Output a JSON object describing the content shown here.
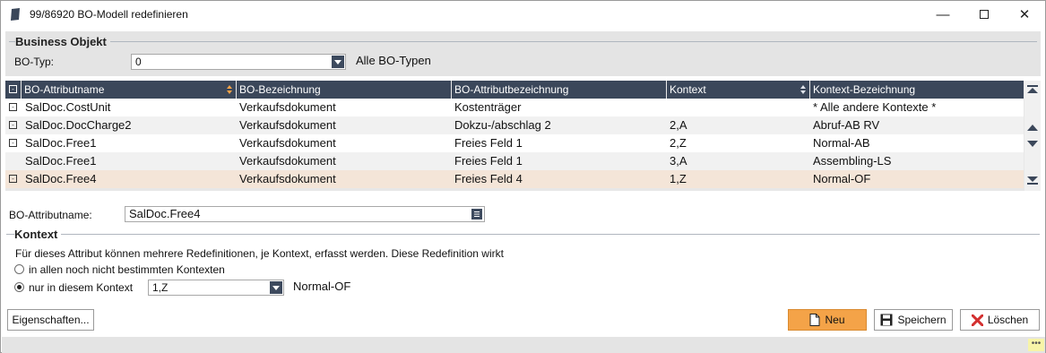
{
  "window": {
    "title": "99/86920 BO-Modell redefinieren",
    "min_label": "—",
    "close_label": "✕"
  },
  "business_objekt": {
    "legend": "Business Objekt",
    "bo_typ_label": "BO-Typ:",
    "bo_typ_value": "0",
    "bo_typ_desc": "Alle BO-Typen"
  },
  "grid": {
    "columns": [
      {
        "label": "BO-Attributname",
        "sorted": true
      },
      {
        "label": "BO-Bezeichnung"
      },
      {
        "label": "BO-Attributbezeichnung"
      },
      {
        "label": "Kontext",
        "sortable": true
      },
      {
        "label": "Kontext-Bezeichnung"
      }
    ],
    "header_expander": "-",
    "rows": [
      {
        "expander": "-",
        "name": "SalDoc.CostUnit",
        "bez": "Verkaufsdokument",
        "attr_bez": "Kostenträger",
        "kontext": "",
        "kontext_bez": "* Alle andere Kontexte *",
        "style": "white"
      },
      {
        "expander": "-",
        "name": "SalDoc.DocCharge2",
        "bez": "Verkaufsdokument",
        "attr_bez": "Dokzu-/abschlag 2",
        "kontext": "2,A",
        "kontext_bez": "Abruf-AB RV",
        "style": "grey"
      },
      {
        "expander": "-",
        "name": "SalDoc.Free1",
        "bez": "Verkaufsdokument",
        "attr_bez": "Freies Feld 1",
        "kontext": "2,Z",
        "kontext_bez": "Normal-AB",
        "style": "white"
      },
      {
        "expander": "",
        "name": "SalDoc.Free1",
        "bez": "Verkaufsdokument",
        "attr_bez": "Freies Feld 1",
        "kontext": "3,A",
        "kontext_bez": "Assembling-LS",
        "style": "grey"
      },
      {
        "expander": "-",
        "name": "SalDoc.Free4",
        "bez": "Verkaufsdokument",
        "attr_bez": "Freies Feld 4",
        "kontext": "1,Z",
        "kontext_bez": "Normal-OF",
        "style": "selected"
      }
    ]
  },
  "attr": {
    "label": "BO-Attributname:",
    "value": "SalDoc.Free4"
  },
  "kontext": {
    "legend": "Kontext",
    "info": "Für dieses Attribut können mehrere Redefinitionen, je Kontext, erfasst werden. Diese Redefinition wirkt",
    "radio_all_label": "in allen noch nicht bestimmten Kontexten",
    "radio_this_label": "nur in diesem Kontext",
    "selected_radio": "this",
    "kontext_value": "1,Z",
    "kontext_desc": "Normal-OF"
  },
  "buttons": {
    "eigenschaften": "Eigenschaften...",
    "neu": "Neu",
    "speichern": "Speichern",
    "loeschen": "Löschen"
  },
  "colors": {
    "header_bg": "#3b475a",
    "selected_row": "#f4e5d8",
    "primary_button": "#f4a348",
    "delete_icon": "#d32f2f"
  },
  "icons": {
    "app": "app-icon",
    "sort": "sort-asc-icon",
    "new": "new-document-icon",
    "save": "floppy-disk-icon",
    "delete": "delete-x-icon"
  }
}
